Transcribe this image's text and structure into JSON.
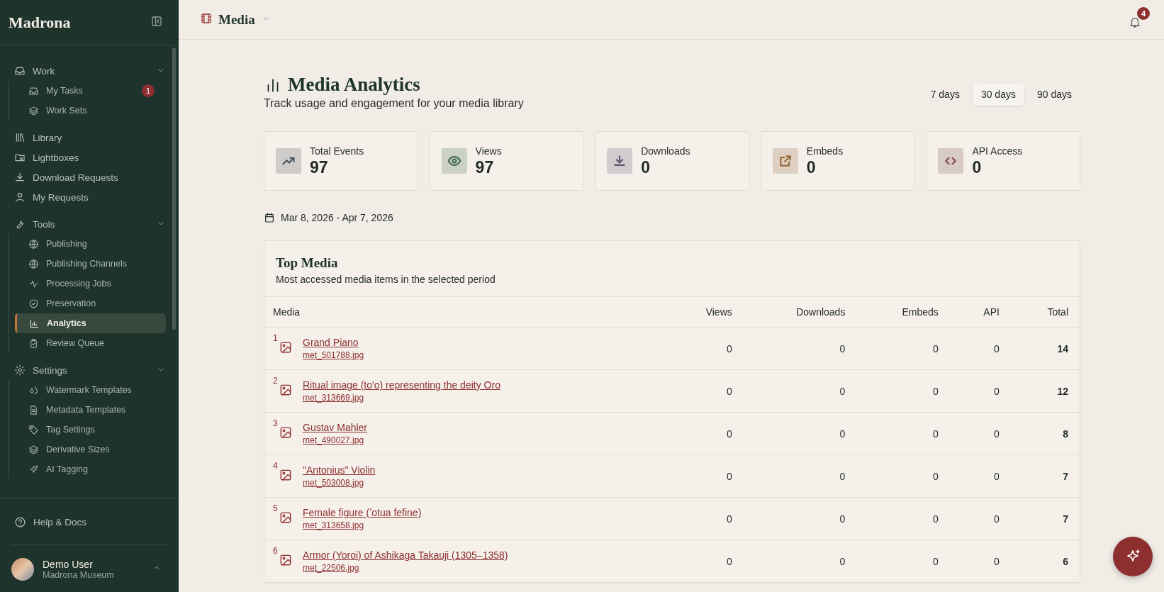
{
  "sidebar": {
    "brand": "Madrona",
    "nav": [
      {
        "kind": "section",
        "label": "Work",
        "expanded": true,
        "children": [
          {
            "label": "My Tasks",
            "badge": "1",
            "selected": false
          },
          {
            "label": "Work Sets",
            "selected": false
          }
        ]
      },
      {
        "kind": "link",
        "label": "Library",
        "selected": false
      },
      {
        "kind": "link",
        "label": "Lightboxes",
        "selected": false
      },
      {
        "kind": "link",
        "label": "Download Requests",
        "selected": false
      },
      {
        "kind": "link",
        "label": "My Requests",
        "selected": false
      },
      {
        "kind": "section",
        "label": "Tools",
        "expanded": true,
        "children": [
          {
            "label": "Publishing",
            "selected": false
          },
          {
            "label": "Publishing Channels",
            "selected": false
          },
          {
            "label": "Processing Jobs",
            "selected": false
          },
          {
            "label": "Preservation",
            "selected": false
          },
          {
            "label": "Analytics",
            "selected": true
          },
          {
            "label": "Review Queue",
            "selected": false
          }
        ]
      },
      {
        "kind": "section",
        "label": "Settings",
        "expanded": true,
        "children": [
          {
            "label": "Watermark Templates",
            "selected": false
          },
          {
            "label": "Metadata Templates",
            "selected": false
          },
          {
            "label": "Tag Settings",
            "selected": false
          },
          {
            "label": "Derivative Sizes",
            "selected": false
          },
          {
            "label": "AI Tagging",
            "selected": false
          }
        ]
      }
    ],
    "help": "Help & Docs",
    "user": {
      "name": "Demo User",
      "org": "Madrona Museum"
    }
  },
  "header": {
    "title": "Media",
    "notifications": "4"
  },
  "page": {
    "title": "Media Analytics",
    "subtitle": "Track usage and engagement for your media library",
    "ranges": [
      {
        "label": "7 days",
        "selected": false
      },
      {
        "label": "30 days",
        "selected": true
      },
      {
        "label": "90 days",
        "selected": false
      }
    ],
    "stats": [
      {
        "label": "Total Events",
        "value": "97",
        "color": "#4b5663"
      },
      {
        "label": "Views",
        "value": "97",
        "color": "#3f6b4a"
      },
      {
        "label": "Downloads",
        "value": "0",
        "color": "#5e5672"
      },
      {
        "label": "Embeds",
        "value": "0",
        "color": "#9a6a3a"
      },
      {
        "label": "API Access",
        "value": "0",
        "color": "#7d4a52"
      }
    ],
    "date_range": "Mar 8, 2026 - Apr 7, 2026"
  },
  "top_media": {
    "title": "Top Media",
    "subtitle": "Most accessed media items in the selected period",
    "columns": [
      "Media",
      "Views",
      "Downloads",
      "Embeds",
      "API",
      "Total"
    ],
    "rows": [
      {
        "rank": "1",
        "title": "Grand Piano",
        "file": "met_501788.jpg",
        "views": "0",
        "downloads": "0",
        "embeds": "0",
        "api": "0",
        "total": "14"
      },
      {
        "rank": "2",
        "title": "Ritual image (to'o) representing the deity Oro",
        "file": "met_313669.jpg",
        "views": "0",
        "downloads": "0",
        "embeds": "0",
        "api": "0",
        "total": "12"
      },
      {
        "rank": "3",
        "title": "Gustav Mahler",
        "file": "met_490027.jpg",
        "views": "0",
        "downloads": "0",
        "embeds": "0",
        "api": "0",
        "total": "8"
      },
      {
        "rank": "4",
        "title": "\"Antonius\" Violin",
        "file": "met_503008.jpg",
        "views": "0",
        "downloads": "0",
        "embeds": "0",
        "api": "0",
        "total": "7"
      },
      {
        "rank": "5",
        "title": "Female figure (ʻotua fefine)",
        "file": "met_313658.jpg",
        "views": "0",
        "downloads": "0",
        "embeds": "0",
        "api": "0",
        "total": "7"
      },
      {
        "rank": "6",
        "title": "Armor (Yoroi) of Ashikaga Takauji (1305–1358)",
        "file": "met_22506.jpg",
        "views": "0",
        "downloads": "0",
        "embeds": "0",
        "api": "0",
        "total": "6"
      }
    ]
  }
}
